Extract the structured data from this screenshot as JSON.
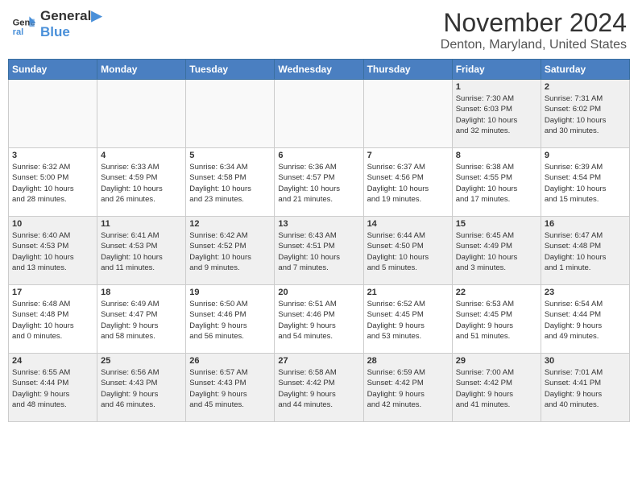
{
  "header": {
    "logo_line1": "General",
    "logo_line2": "Blue",
    "month": "November 2024",
    "location": "Denton, Maryland, United States"
  },
  "days_of_week": [
    "Sunday",
    "Monday",
    "Tuesday",
    "Wednesday",
    "Thursday",
    "Friday",
    "Saturday"
  ],
  "weeks": [
    [
      {
        "day": "",
        "info": ""
      },
      {
        "day": "",
        "info": ""
      },
      {
        "day": "",
        "info": ""
      },
      {
        "day": "",
        "info": ""
      },
      {
        "day": "",
        "info": ""
      },
      {
        "day": "1",
        "info": "Sunrise: 7:30 AM\nSunset: 6:03 PM\nDaylight: 10 hours\nand 32 minutes."
      },
      {
        "day": "2",
        "info": "Sunrise: 7:31 AM\nSunset: 6:02 PM\nDaylight: 10 hours\nand 30 minutes."
      }
    ],
    [
      {
        "day": "3",
        "info": "Sunrise: 6:32 AM\nSunset: 5:00 PM\nDaylight: 10 hours\nand 28 minutes."
      },
      {
        "day": "4",
        "info": "Sunrise: 6:33 AM\nSunset: 4:59 PM\nDaylight: 10 hours\nand 26 minutes."
      },
      {
        "day": "5",
        "info": "Sunrise: 6:34 AM\nSunset: 4:58 PM\nDaylight: 10 hours\nand 23 minutes."
      },
      {
        "day": "6",
        "info": "Sunrise: 6:36 AM\nSunset: 4:57 PM\nDaylight: 10 hours\nand 21 minutes."
      },
      {
        "day": "7",
        "info": "Sunrise: 6:37 AM\nSunset: 4:56 PM\nDaylight: 10 hours\nand 19 minutes."
      },
      {
        "day": "8",
        "info": "Sunrise: 6:38 AM\nSunset: 4:55 PM\nDaylight: 10 hours\nand 17 minutes."
      },
      {
        "day": "9",
        "info": "Sunrise: 6:39 AM\nSunset: 4:54 PM\nDaylight: 10 hours\nand 15 minutes."
      }
    ],
    [
      {
        "day": "10",
        "info": "Sunrise: 6:40 AM\nSunset: 4:53 PM\nDaylight: 10 hours\nand 13 minutes."
      },
      {
        "day": "11",
        "info": "Sunrise: 6:41 AM\nSunset: 4:53 PM\nDaylight: 10 hours\nand 11 minutes."
      },
      {
        "day": "12",
        "info": "Sunrise: 6:42 AM\nSunset: 4:52 PM\nDaylight: 10 hours\nand 9 minutes."
      },
      {
        "day": "13",
        "info": "Sunrise: 6:43 AM\nSunset: 4:51 PM\nDaylight: 10 hours\nand 7 minutes."
      },
      {
        "day": "14",
        "info": "Sunrise: 6:44 AM\nSunset: 4:50 PM\nDaylight: 10 hours\nand 5 minutes."
      },
      {
        "day": "15",
        "info": "Sunrise: 6:45 AM\nSunset: 4:49 PM\nDaylight: 10 hours\nand 3 minutes."
      },
      {
        "day": "16",
        "info": "Sunrise: 6:47 AM\nSunset: 4:48 PM\nDaylight: 10 hours\nand 1 minute."
      }
    ],
    [
      {
        "day": "17",
        "info": "Sunrise: 6:48 AM\nSunset: 4:48 PM\nDaylight: 10 hours\nand 0 minutes."
      },
      {
        "day": "18",
        "info": "Sunrise: 6:49 AM\nSunset: 4:47 PM\nDaylight: 9 hours\nand 58 minutes."
      },
      {
        "day": "19",
        "info": "Sunrise: 6:50 AM\nSunset: 4:46 PM\nDaylight: 9 hours\nand 56 minutes."
      },
      {
        "day": "20",
        "info": "Sunrise: 6:51 AM\nSunset: 4:46 PM\nDaylight: 9 hours\nand 54 minutes."
      },
      {
        "day": "21",
        "info": "Sunrise: 6:52 AM\nSunset: 4:45 PM\nDaylight: 9 hours\nand 53 minutes."
      },
      {
        "day": "22",
        "info": "Sunrise: 6:53 AM\nSunset: 4:45 PM\nDaylight: 9 hours\nand 51 minutes."
      },
      {
        "day": "23",
        "info": "Sunrise: 6:54 AM\nSunset: 4:44 PM\nDaylight: 9 hours\nand 49 minutes."
      }
    ],
    [
      {
        "day": "24",
        "info": "Sunrise: 6:55 AM\nSunset: 4:44 PM\nDaylight: 9 hours\nand 48 minutes."
      },
      {
        "day": "25",
        "info": "Sunrise: 6:56 AM\nSunset: 4:43 PM\nDaylight: 9 hours\nand 46 minutes."
      },
      {
        "day": "26",
        "info": "Sunrise: 6:57 AM\nSunset: 4:43 PM\nDaylight: 9 hours\nand 45 minutes."
      },
      {
        "day": "27",
        "info": "Sunrise: 6:58 AM\nSunset: 4:42 PM\nDaylight: 9 hours\nand 44 minutes."
      },
      {
        "day": "28",
        "info": "Sunrise: 6:59 AM\nSunset: 4:42 PM\nDaylight: 9 hours\nand 42 minutes."
      },
      {
        "day": "29",
        "info": "Sunrise: 7:00 AM\nSunset: 4:42 PM\nDaylight: 9 hours\nand 41 minutes."
      },
      {
        "day": "30",
        "info": "Sunrise: 7:01 AM\nSunset: 4:41 PM\nDaylight: 9 hours\nand 40 minutes."
      }
    ]
  ]
}
